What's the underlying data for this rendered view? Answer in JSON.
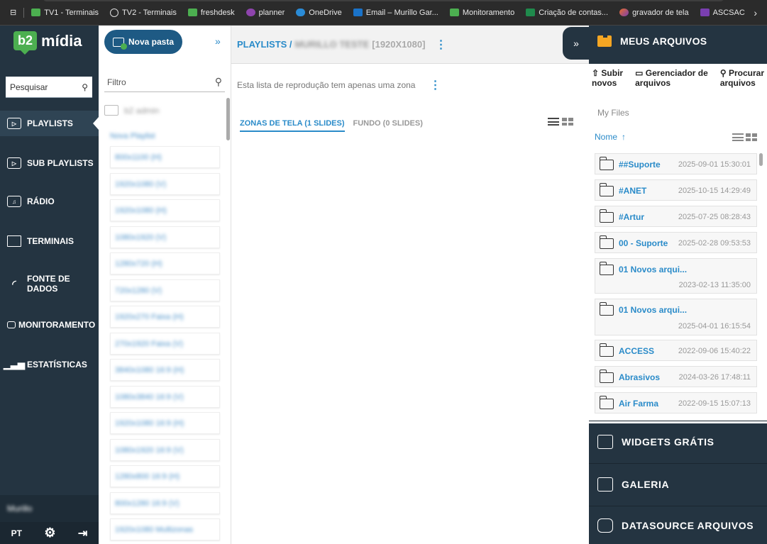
{
  "bookmarks": [
    {
      "label": "TV1 - Terminais",
      "icon": "b2-icon",
      "color": "#4caf50"
    },
    {
      "label": "TV2 - Terminais",
      "icon": "globe-icon",
      "color": ""
    },
    {
      "label": "freshdesk",
      "icon": "b2-icon",
      "color": "#4caf50"
    },
    {
      "label": "planner",
      "icon": "planner-icon",
      "color": "#8e44ad"
    },
    {
      "label": "OneDrive",
      "icon": "onedrive-icon",
      "color": "#2a8bd6"
    },
    {
      "label": "Email – Murillo Gar...",
      "icon": "outlook-icon",
      "color": "#1a73c9"
    },
    {
      "label": "Monitoramento",
      "icon": "b2-icon",
      "color": "#4caf50"
    },
    {
      "label": "Criação de contas...",
      "icon": "excel-icon",
      "color": "#1f8a4c"
    },
    {
      "label": "gravador de tela",
      "icon": "copilot-icon",
      "color": "#e86e2a"
    },
    {
      "label": "ASCSAC",
      "icon": "ascsac-icon",
      "color": "#7a3fb0"
    }
  ],
  "brand": {
    "badge": "b2",
    "name": "mídia"
  },
  "nav": {
    "search_label": "Pesquisar",
    "items": [
      {
        "label": "PLAYLISTS",
        "icon": "play-icon",
        "active": true
      },
      {
        "label": "SUB PLAYLISTS",
        "icon": "sub-playlist-icon",
        "active": false
      },
      {
        "label": "RÁDIO",
        "icon": "music-icon",
        "active": false
      },
      {
        "label": "TERMINAIS",
        "icon": "monitor-icon",
        "active": false
      },
      {
        "label": "FONTE DE",
        "label2": "DADOS",
        "icon": "rss-icon",
        "active": false
      },
      {
        "label": "MONITORAMENTO",
        "icon": "monitor-small-icon",
        "active": false
      },
      {
        "label": "ESTATÍSTICAS",
        "icon": "stats-icon",
        "active": false
      }
    ],
    "user": "Murillo",
    "language": "PT"
  },
  "folders": {
    "new_folder": "Nova pasta",
    "filter_placeholder": "Filtro",
    "root": "b2 admin",
    "sub": "Nova Playlist",
    "playlists": [
      "800x1100 (H)",
      "1920x1080 (V)",
      "1920x1080 (H)",
      "1080x1920 (V)",
      "1280x720 (H)",
      "720x1280 (V)",
      "1920x270 Faixa (H)",
      "270x1920 Faixa (V)",
      "3840x1080 16:9 (H)",
      "1080x3840 16:9 (V)",
      "1920x1080 16:9 (H)",
      "1080x1920 16:9 (V)",
      "1280x800 16:9 (H)",
      "800x1280 16:9 (V)",
      "1920x1080 Multizonas"
    ]
  },
  "main": {
    "breadcrumb": "PLAYLISTS /",
    "playlist_name": "MURILLO TESTE",
    "resolution": "[1920X1080]",
    "zone_note": "Esta lista de reprodução tem apenas uma zona",
    "tab_zones": "ZONAS DE TELA (1 SLIDES)",
    "tab_background": "FUNDO (0 SLIDES)"
  },
  "right": {
    "title": "MEUS ARQUIVOS",
    "upload": "Subir",
    "upload2": "novos",
    "manager": "Gerenciador de",
    "manager2": "arquivos",
    "search": "Procurar",
    "search2": "arquivos",
    "myfiles": "My Files",
    "sort_label": "Nome",
    "files": [
      {
        "name": "##Suporte",
        "date": "2025-09-01 15:30:01"
      },
      {
        "name": "#ANET",
        "date": "2025-10-15 14:29:49"
      },
      {
        "name": "#Artur",
        "date": "2025-07-25 08:28:43"
      },
      {
        "name": "00 - Suporte",
        "date": "2025-02-28 09:53:53"
      },
      {
        "name": "01 Novos arqui...",
        "date": "2023-02-13 11:35:00"
      },
      {
        "name": "01 Novos arqui...",
        "date": "2025-04-01 16:15:54"
      },
      {
        "name": "ACCESS",
        "date": "2022-09-06 15:40:22"
      },
      {
        "name": "Abrasivos",
        "date": "2024-03-26 17:48:11"
      },
      {
        "name": "Air Farma",
        "date": "2022-09-15 15:07:13"
      }
    ],
    "sections": [
      "WIDGETS GRÁTIS",
      "GALERIA",
      "DATASOURCE ARQUIVOS"
    ]
  },
  "colors": {
    "accent": "#2a8bc9",
    "nav_bg": "#243441",
    "brand_green": "#4caf50",
    "folder_orange": "#f5a623"
  }
}
